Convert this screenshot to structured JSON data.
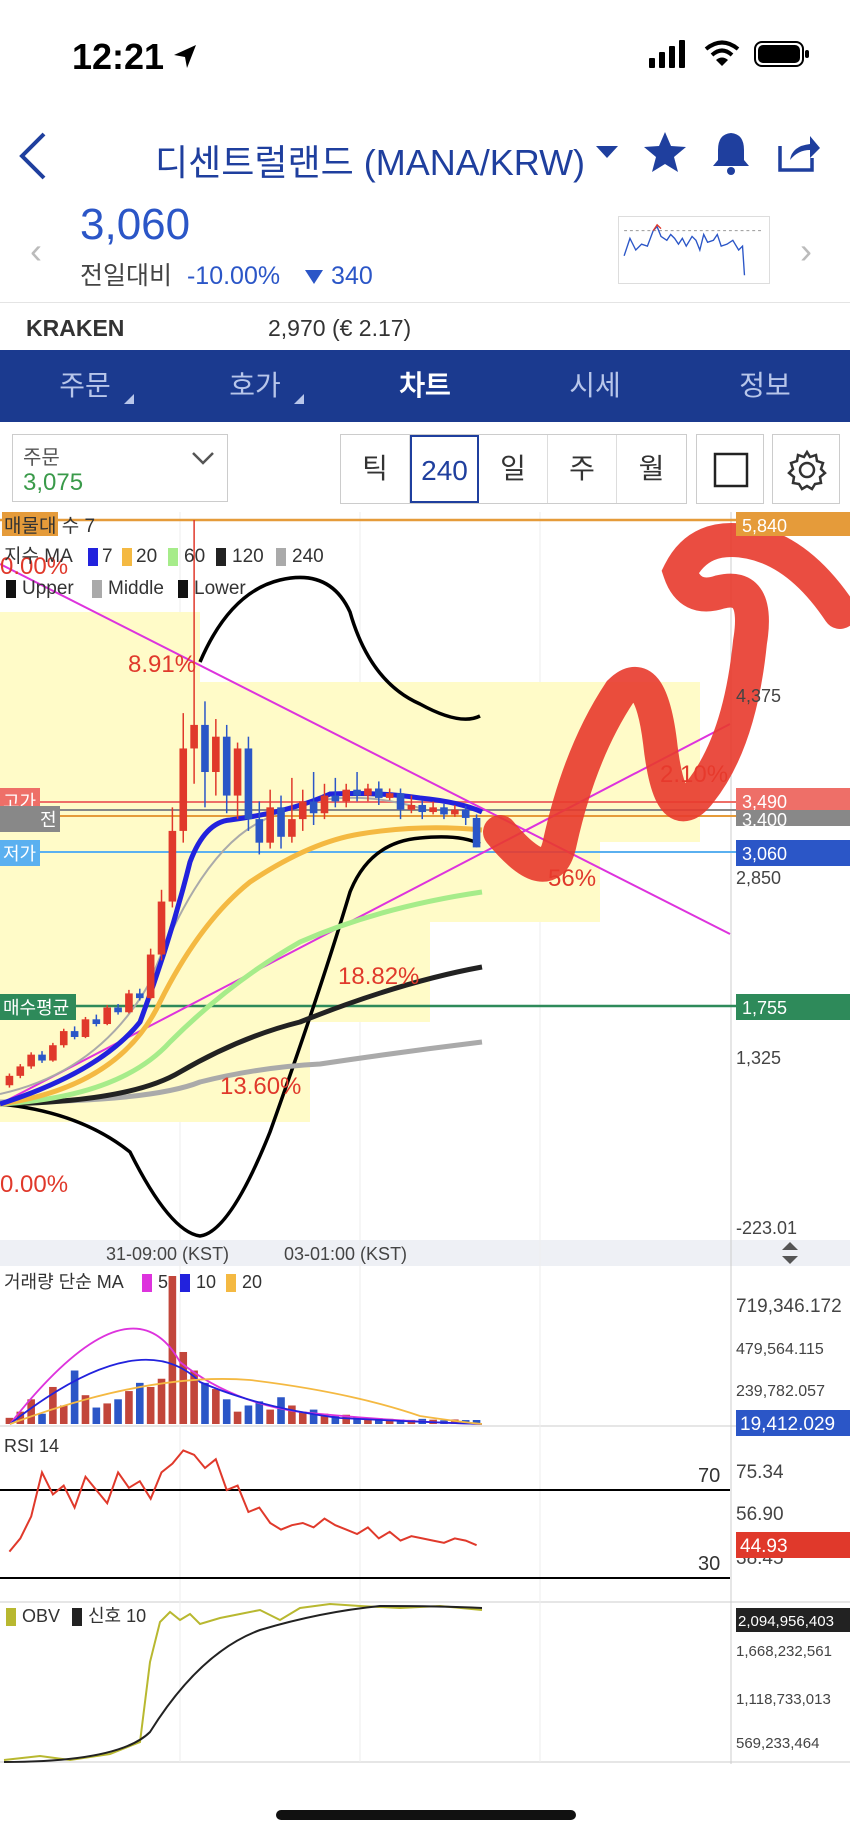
{
  "status": {
    "time": "12:21"
  },
  "header": {
    "title": "디센트럴랜드 (MANA/KRW)"
  },
  "price": {
    "current": "3,060",
    "change_label": "전일대비",
    "change_pct": "-10.00%",
    "change_amt": "340"
  },
  "kraken": {
    "name": "KRAKEN",
    "value": "2,970 (€ 2.17)"
  },
  "tabs": [
    {
      "label": "주문",
      "has_menu": true
    },
    {
      "label": "호가",
      "has_menu": true
    },
    {
      "label": "차트",
      "active": true
    },
    {
      "label": "시세"
    },
    {
      "label": "정보"
    }
  ],
  "toolbar": {
    "order_label": "주문",
    "order_value": "3,075",
    "periods": [
      "틱",
      "240",
      "일",
      "주",
      "월"
    ],
    "active_period": "240"
  },
  "colors": {
    "brand_blue": "#1b3a8f",
    "up_red": "#e0392b",
    "down_blue": "#2b56c7",
    "ma7": "#2222dd",
    "ma20": "#f4b942",
    "ma60": "#a6ec8a",
    "ma120": "#222222",
    "ma240": "#aaaaaa",
    "trend_magenta": "#dd33dd",
    "highlight_yellow": "#fffbc8"
  },
  "chart_data": [
    {
      "type": "candlestick",
      "legend": {
        "volume_profile": "매물대 수 7",
        "ma_title": "지수 MA",
        "ma_periods": [
          "7",
          "20",
          "60",
          "120",
          "240"
        ],
        "bb": [
          "Upper",
          "Middle",
          "Lower"
        ]
      },
      "y_axis_labels": [
        "5,840",
        "4,375",
        "3,490",
        "3,400",
        "3,060",
        "2,850",
        "1,755",
        "1,325",
        "-223.01"
      ],
      "price_tags": [
        {
          "label": "고가",
          "value": "3,490",
          "color": "#ee6f68"
        },
        {
          "label": "전",
          "value": "3,400",
          "color": "#888888"
        },
        {
          "label": "저가",
          "value": "3,060",
          "color": "#2b56c7"
        },
        {
          "label": "매수평균",
          "value": "1,755",
          "color": "#2e8a5a"
        },
        {
          "label": "",
          "value": "5,840",
          "color": "#e59b3a"
        }
      ],
      "annotations": [
        "0.00%",
        "8.91%",
        "18.82%",
        "13.60%",
        "0.00%",
        "2.10%",
        "56%"
      ],
      "x_labels": [
        "31-09:00 (KST)",
        "03-01:00 (KST)"
      ],
      "candles": [
        [
          1040,
          1120,
          1020,
          1140
        ],
        [
          1120,
          1200,
          1100,
          1220
        ],
        [
          1200,
          1300,
          1180,
          1320
        ],
        [
          1300,
          1250,
          1230,
          1330
        ],
        [
          1250,
          1380,
          1240,
          1400
        ],
        [
          1380,
          1500,
          1360,
          1520
        ],
        [
          1500,
          1450,
          1430,
          1540
        ],
        [
          1450,
          1600,
          1440,
          1620
        ],
        [
          1600,
          1560,
          1540,
          1640
        ],
        [
          1560,
          1700,
          1550,
          1720
        ],
        [
          1700,
          1660,
          1640,
          1730
        ],
        [
          1660,
          1820,
          1650,
          1850
        ],
        [
          1820,
          1780,
          1760,
          1860
        ],
        [
          1780,
          2150,
          1770,
          2200
        ],
        [
          2150,
          2600,
          2100,
          2700
        ],
        [
          2600,
          3200,
          2550,
          3400
        ],
        [
          3200,
          3900,
          3100,
          4200
        ],
        [
          3900,
          4100,
          3600,
          5840
        ],
        [
          4100,
          3700,
          3400,
          4300
        ],
        [
          3700,
          4000,
          3500,
          4150
        ],
        [
          4000,
          3500,
          3350,
          4100
        ],
        [
          3500,
          3900,
          3300,
          3950
        ],
        [
          3900,
          3300,
          3200,
          4000
        ],
        [
          3300,
          3100,
          3000,
          3450
        ],
        [
          3100,
          3400,
          3050,
          3550
        ],
        [
          3400,
          3150,
          3050,
          3500
        ],
        [
          3150,
          3300,
          3100,
          3650
        ],
        [
          3300,
          3450,
          3200,
          3550
        ],
        [
          3450,
          3350,
          3250,
          3700
        ],
        [
          3350,
          3500,
          3300,
          3600
        ],
        [
          3500,
          3450,
          3400,
          3650
        ],
        [
          3450,
          3550,
          3400,
          3600
        ],
        [
          3550,
          3500,
          3450,
          3700
        ],
        [
          3500,
          3560,
          3450,
          3600
        ],
        [
          3560,
          3480,
          3420,
          3620
        ],
        [
          3480,
          3520,
          3460,
          3560
        ],
        [
          3520,
          3380,
          3300,
          3560
        ],
        [
          3380,
          3420,
          3350,
          3500
        ],
        [
          3420,
          3360,
          3300,
          3460
        ],
        [
          3360,
          3400,
          3340,
          3450
        ],
        [
          3400,
          3340,
          3300,
          3430
        ],
        [
          3340,
          3380,
          3320,
          3420
        ],
        [
          3380,
          3310,
          3250,
          3410
        ],
        [
          3310,
          3060,
          3060,
          3340
        ]
      ]
    },
    {
      "type": "bar",
      "title": "거래량 단순 MA",
      "legend": [
        "5",
        "10",
        "20"
      ],
      "y_axis_labels": [
        "719,346.172",
        "479,564.115",
        "239,782.057",
        "19,412.029"
      ],
      "values": [
        30000,
        60000,
        120000,
        50000,
        180000,
        90000,
        260000,
        140000,
        80000,
        100000,
        120000,
        160000,
        200000,
        180000,
        220000,
        719346,
        350000,
        260000,
        200000,
        170000,
        120000,
        60000,
        90000,
        110000,
        70000,
        130000,
        90000,
        60000,
        70000,
        50000,
        40000,
        45000,
        35000,
        30000,
        28000,
        25000,
        22000,
        20000,
        25000,
        21000,
        18000,
        22000,
        19000,
        19412
      ]
    },
    {
      "type": "line",
      "title": "RSI 14",
      "levels": [
        "70",
        "30"
      ],
      "y_axis_labels": [
        "75.34",
        "56.90",
        "44.93",
        "38.45"
      ],
      "values": [
        42,
        48,
        58,
        78,
        68,
        72,
        62,
        76,
        70,
        64,
        78,
        71,
        74,
        66,
        78,
        82,
        88,
        86,
        80,
        84,
        70,
        72,
        60,
        62,
        55,
        52,
        54,
        55,
        53,
        57,
        54,
        52,
        50,
        53,
        48,
        51,
        47,
        49,
        48,
        47,
        46,
        48,
        47,
        44.93
      ]
    },
    {
      "type": "line",
      "title": "OBV",
      "legend": [
        "신호 10"
      ],
      "y_axis_labels": [
        "2,094,956,403",
        "1,668,232,561",
        "1,118,733,013",
        "569,233,464"
      ]
    }
  ]
}
